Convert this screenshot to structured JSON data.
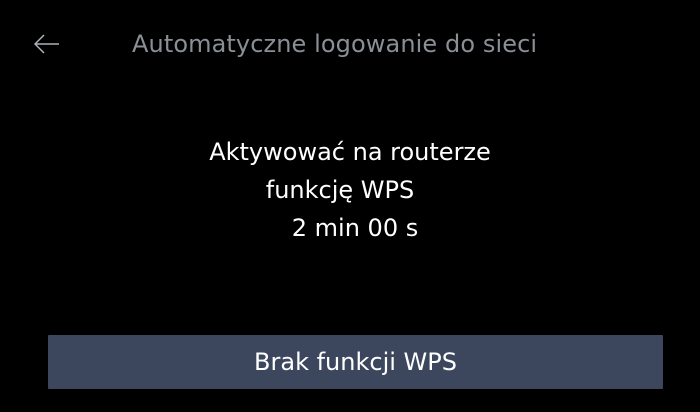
{
  "header": {
    "back_icon": "arrow-left-icon",
    "title": "Automatyczne logowanie do sieci"
  },
  "message": {
    "line1": "Aktywować na routerze",
    "line2": "funkcję WPS",
    "countdown": "2 min 00 s"
  },
  "actions": {
    "no_wps_label": "Brak funkcji WPS"
  },
  "colors": {
    "background": "#000000",
    "title_text": "#8a8f96",
    "body_text": "#ffffff",
    "button_background": "#3c475e"
  }
}
